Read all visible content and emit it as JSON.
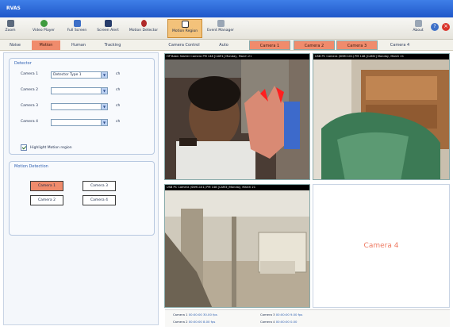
{
  "window": {
    "title": "RVAS"
  },
  "toolbar": [
    {
      "label": "Zoom",
      "icon": "zoom-icon",
      "color": "#5c6a7d"
    },
    {
      "label": "Video Player",
      "icon": "video-player-icon",
      "color": "#3f9b3f"
    },
    {
      "label": "Full Screen",
      "icon": "full-screen-icon",
      "color": "#3d6fc7"
    },
    {
      "label": "Screen Alert",
      "icon": "screen-alert-icon",
      "color": "#283d6b"
    },
    {
      "label": "Motion Detector",
      "icon": "motion-detector-icon",
      "color": "#b02a2a"
    },
    {
      "label": "Motion Region",
      "icon": "motion-region-icon",
      "color": "#ffffff"
    },
    {
      "label": "Event Manager",
      "icon": "event-manager-icon",
      "color": "#9aa6b5"
    },
    {
      "label": "About",
      "icon": "about-icon",
      "color": "#9aa6b5"
    }
  ],
  "window_controls": {
    "help": "?",
    "close": "×"
  },
  "tabs": [
    "Noise",
    "Motion",
    "Human",
    "Tracking",
    "Camera Control",
    "Auto",
    "Camera 1",
    "Camera 2",
    "Camera 3",
    "Camera 4"
  ],
  "detector_panel": {
    "title": "Detector",
    "rows": [
      {
        "name": "Camera 1",
        "value": "Detector Type 1",
        "ch": "ch"
      },
      {
        "name": "Camera 2",
        "value": "",
        "ch": "ch"
      },
      {
        "name": "Camera 3",
        "value": "",
        "ch": "ch"
      },
      {
        "name": "Camera 4",
        "value": "",
        "ch": "ch"
      }
    ],
    "highlight_label": "Highlight Motion region"
  },
  "motion_panel": {
    "title": "Motion Detection",
    "buttons": [
      "Camera 1",
      "Camera 3",
      "Camera 2",
      "Camera 4"
    ]
  },
  "cameras": [
    {
      "caption": "HP Basic Starter Camera  PM 148 [CAM1]  Monday, March 21"
    },
    {
      "caption": "USB PC Camera (SN9C101)  PM 148 [CAM2]  Monday, March 21"
    },
    {
      "caption": "USB PC Camera (SN9C101)  PM 148 [CAM3]  Monday, March 21"
    }
  ],
  "empty_camera": {
    "label": "Camera 4"
  },
  "status": [
    {
      "name": "Camera 1",
      "value": "00:00:00  30.00 fps"
    },
    {
      "name": "Camera 2",
      "value": "00:00:00  8.00 fps"
    },
    {
      "name": "Camera 3",
      "value": "00:00:00  9.00 fps"
    },
    {
      "name": "Camera 4",
      "value": "00:00:00  0.00"
    }
  ]
}
